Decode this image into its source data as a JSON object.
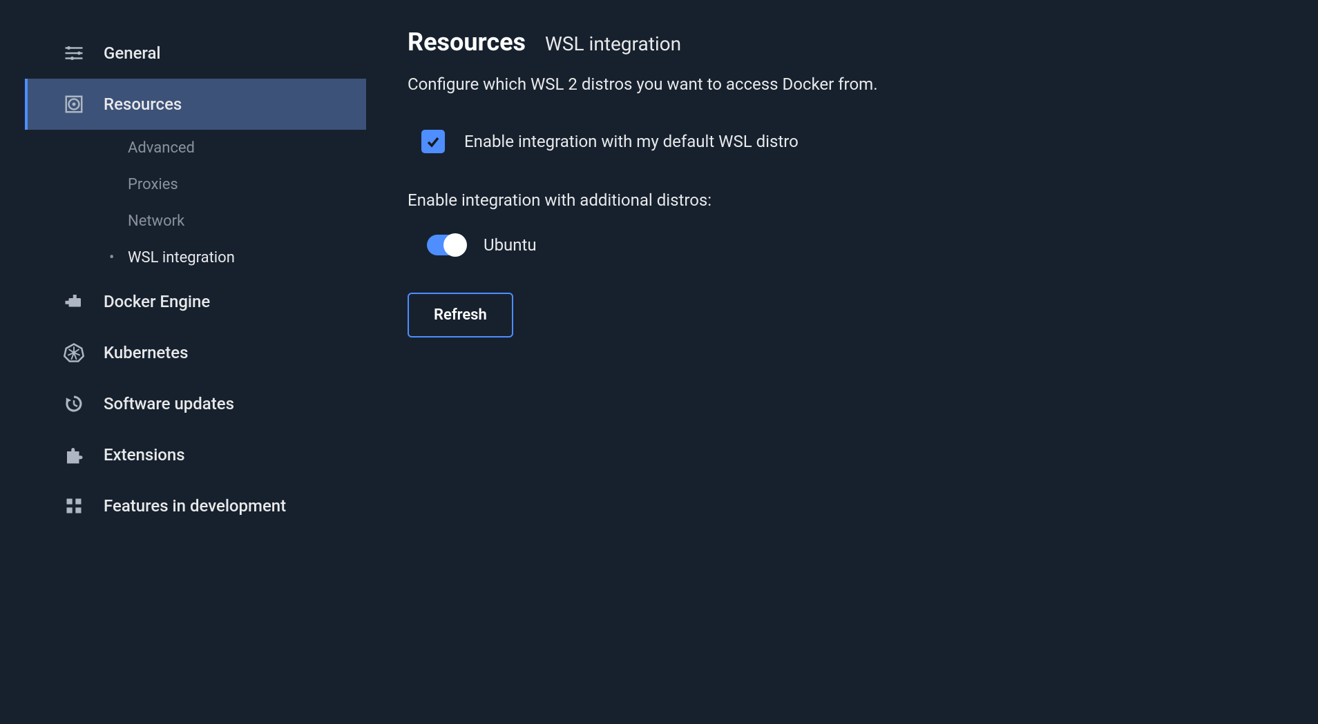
{
  "sidebar": {
    "items": [
      {
        "label": "General"
      },
      {
        "label": "Resources"
      },
      {
        "label": "Docker Engine"
      },
      {
        "label": "Kubernetes"
      },
      {
        "label": "Software updates"
      },
      {
        "label": "Extensions"
      },
      {
        "label": "Features in development"
      }
    ],
    "resources_subitems": [
      {
        "label": "Advanced"
      },
      {
        "label": "Proxies"
      },
      {
        "label": "Network"
      },
      {
        "label": "WSL integration"
      }
    ]
  },
  "main": {
    "title": "Resources",
    "subtitle": "WSL integration",
    "description": "Configure which WSL 2 distros you want to access Docker from.",
    "default_checkbox_label": "Enable integration with my default WSL distro",
    "additional_label": "Enable integration with additional distros:",
    "distros": [
      {
        "name": "Ubuntu",
        "enabled": true
      }
    ],
    "refresh_label": "Refresh"
  }
}
